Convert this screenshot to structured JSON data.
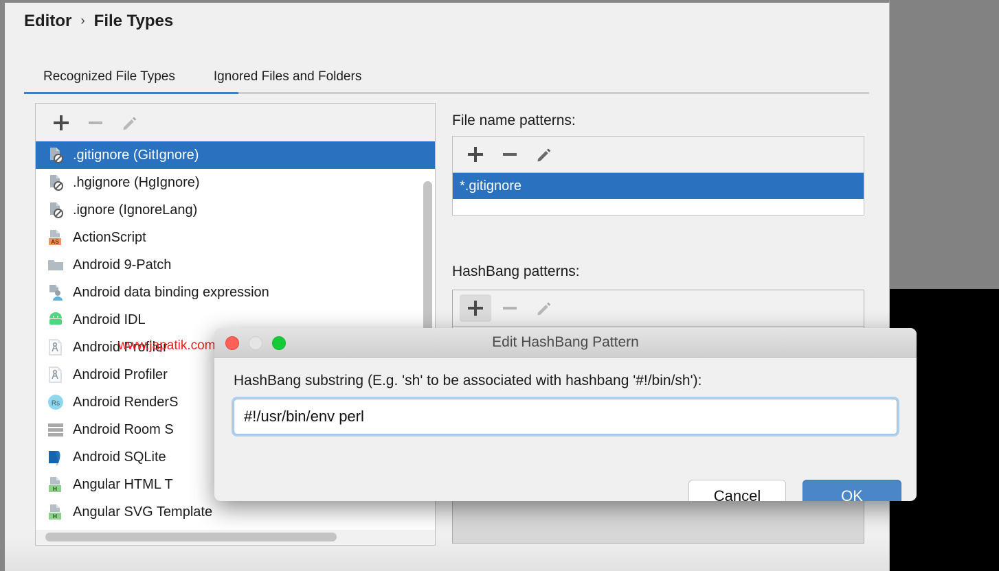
{
  "window": {
    "breadcrumb": {
      "root": "Editor",
      "separator": "›",
      "current": "File Types"
    }
  },
  "tabs": [
    {
      "label": "Recognized File Types",
      "active": true
    },
    {
      "label": "Ignored Files and Folders",
      "active": false
    }
  ],
  "file_types_panel": {
    "toolbar": {
      "add": "+",
      "remove": "−",
      "edit": "pencil-icon"
    },
    "items": [
      {
        "label": ".gitignore (GitIgnore)",
        "icon": "file-ignore-icon",
        "selected": true
      },
      {
        "label": ".hgignore (HgIgnore)",
        "icon": "file-ignore-icon",
        "selected": false
      },
      {
        "label": ".ignore (IgnoreLang)",
        "icon": "file-ignore-icon",
        "selected": false
      },
      {
        "label": "ActionScript",
        "icon": "actionscript-icon",
        "selected": false
      },
      {
        "label": "Android 9-Patch",
        "icon": "folder-icon",
        "selected": false
      },
      {
        "label": "Android data binding expression",
        "icon": "android-databinding-icon",
        "selected": false
      },
      {
        "label": "Android IDL",
        "icon": "android-robot-icon",
        "selected": false
      },
      {
        "label": "Android Profiler",
        "icon": "android-profiler-icon",
        "selected": false
      },
      {
        "label": "Android Profiler",
        "icon": "android-profiler-icon",
        "selected": false
      },
      {
        "label": "Android RenderS",
        "icon": "renderscript-icon",
        "selected": false
      },
      {
        "label": "Android Room S",
        "icon": "android-room-icon",
        "selected": false
      },
      {
        "label": "Android SQLite",
        "icon": "sqlite-icon",
        "selected": false
      },
      {
        "label": "Angular HTML T",
        "icon": "angular-html-icon",
        "selected": false
      },
      {
        "label": "Angular SVG Template",
        "icon": "angular-html-icon",
        "selected": false
      }
    ]
  },
  "file_name_patterns": {
    "label": "File name patterns:",
    "toolbar": {
      "add": "+",
      "remove": "−",
      "edit": "pencil-icon"
    },
    "items": [
      {
        "label": "*.gitignore",
        "selected": true
      }
    ]
  },
  "hashbang_patterns": {
    "label": "HashBang patterns:",
    "toolbar": {
      "add": "+",
      "remove": "−",
      "edit": "pencil-icon"
    },
    "items": []
  },
  "dialog": {
    "title": "Edit HashBang Pattern",
    "prompt": "HashBang substring (E.g. 'sh' to be associated with hashbang '#!/bin/sh'):",
    "input_value": "#!/usr/bin/env perl",
    "input_placeholder": "",
    "cancel_label": "Cancel",
    "ok_label": "OK"
  },
  "watermark": {
    "text": "www.japatik.com"
  },
  "colors": {
    "accent": "#2a72c0",
    "tab_underline": "#3f7fc1",
    "ok_button": "#4a86c8",
    "backdrop": "#828282",
    "window_bg": "#f0f0f0"
  }
}
